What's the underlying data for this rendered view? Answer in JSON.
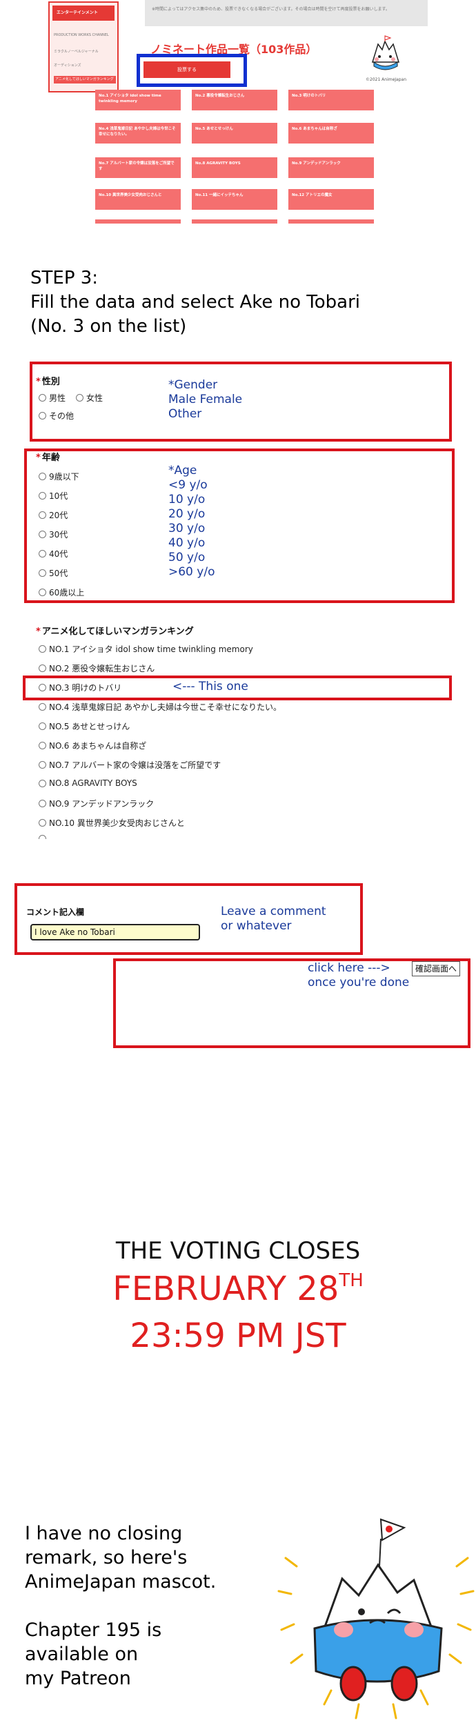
{
  "site": {
    "side_menu": {
      "header": "エンターテインメント",
      "items": [
        "PRODUCTION WORKS CHANNEL",
        "ミラクルノーベルジャーナル",
        "オーディションズ",
        "アニメ化してほしいマンガランキング"
      ]
    },
    "notice": "※時間によってはアクセス集中のため、投票できなくなる場合がございます。その場合は時間を空けて再度投票をお願いします。",
    "title": "ノミネート作品一覧（103作品）",
    "vote_button": "投票する",
    "copyright": "©2021 AnimeJapan",
    "tiles": [
      "No.1 アイショタ idol show time twinkling memory",
      "No.2 悪役令嬢転生おじさん",
      "No.3 明けのトバリ",
      "No.4 浅草鬼嫁日記 あやかし夫婦は今世こそ幸せになりたい。",
      "No.5 あせとせっけん",
      "No.6 あまちゃんは自称ざ",
      "No.7 アルバート家の令嬢は没落をご所望です",
      "No.8 AGRAVITY BOYS",
      "No.9 アンデッドアンラック",
      "No.10 異世界美少女受肉おじさんと",
      "No.11 一緒にイッテちゃん",
      "No.12 アトリエの魔女"
    ]
  },
  "step": {
    "text": "STEP 3:\nFill the data and select Ake no Tobari\n(No. 3 on the list)"
  },
  "gender": {
    "label": "性別",
    "options": [
      "男性",
      "女性",
      "その他"
    ],
    "note": "*Gender\nMale      Female\nOther"
  },
  "age": {
    "label": "年齢",
    "options": [
      "9歳以下",
      "10代",
      "20代",
      "30代",
      "40代",
      "50代",
      "60歳以上"
    ],
    "note": "*Age\n<9 y/o\n10 y/o\n20 y/o\n30 y/o\n40 y/o\n50 y/o\n>60 y/o"
  },
  "ranking": {
    "label": "アニメ化してほしいマンガランキング",
    "options": [
      "NO.1 アイショタ idol show time twinkling memory",
      "NO.2 悪役令嬢転生おじさん",
      "NO.3 明けのトバリ",
      "NO.4 浅草鬼嫁日記 あやかし夫婦は今世こそ幸せになりたい。",
      "NO.5 あせとせっけん",
      "NO.6 あまちゃんは自称ざ",
      "NO.7 アルバート家の令嬢は没落をご所望です",
      "NO.8 AGRAVITY BOYS",
      "NO.9 アンデッドアンラック",
      "NO.10 異世界美少女受肉おじさんと"
    ],
    "note": "<--- This one"
  },
  "comment": {
    "label": "コメント記入欄",
    "value": "I love Ake no Tobari",
    "note": "Leave a comment\nor whatever"
  },
  "confirm": {
    "note": "click here --->\nonce you're done",
    "button": "確認画面へ"
  },
  "closing": {
    "line1": "THE VOTING CLOSES",
    "date": "FEBRUARY 28",
    "date_suffix": "TH",
    "time": "23:59 PM JST"
  },
  "outro": {
    "text": "I have no closing\nremark, so here's\nAnimeJapan mascot.\n\nChapter 195 is\navailable on\nmy Patreon"
  },
  "colors": {
    "accent_red": "#e53935",
    "highlight_red": "#d9141c",
    "highlight_blue": "#1030d0",
    "note_blue": "#1a3a9a"
  }
}
